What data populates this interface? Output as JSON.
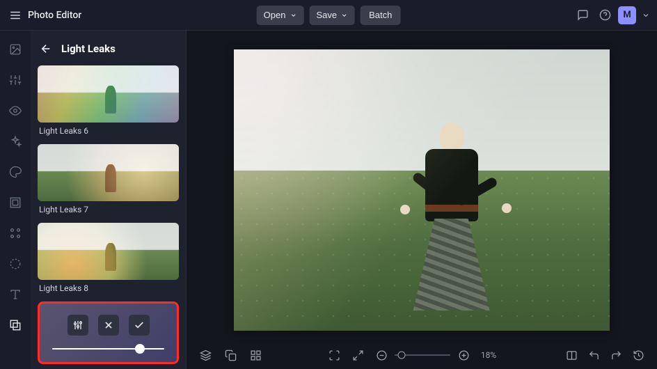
{
  "app_title": "Photo Editor",
  "topbar": {
    "open_label": "Open",
    "save_label": "Save",
    "batch_label": "Batch",
    "avatar_initial": "M"
  },
  "panel": {
    "title": "Light Leaks",
    "presets": [
      {
        "label": "Light Leaks 6"
      },
      {
        "label": "Light Leaks 7"
      },
      {
        "label": "Light Leaks 8"
      }
    ],
    "slider_value_percent": 78
  },
  "bottombar": {
    "zoom_percent_label": "18%"
  }
}
